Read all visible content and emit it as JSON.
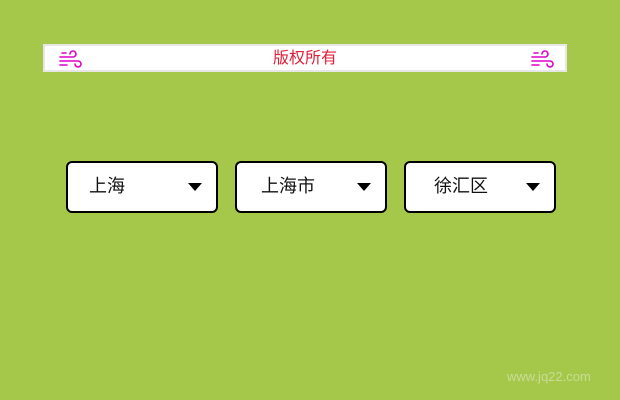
{
  "banner": {
    "text": "版权所有",
    "icon": "wind-icon"
  },
  "selects": [
    {
      "value": "上海"
    },
    {
      "value": "上海市"
    },
    {
      "value": "徐汇区"
    }
  ],
  "watermark": "www.jq22.com",
  "colors": {
    "background": "#a5c84a",
    "banner_text": "#e0203a",
    "icon": "#e000c8"
  }
}
